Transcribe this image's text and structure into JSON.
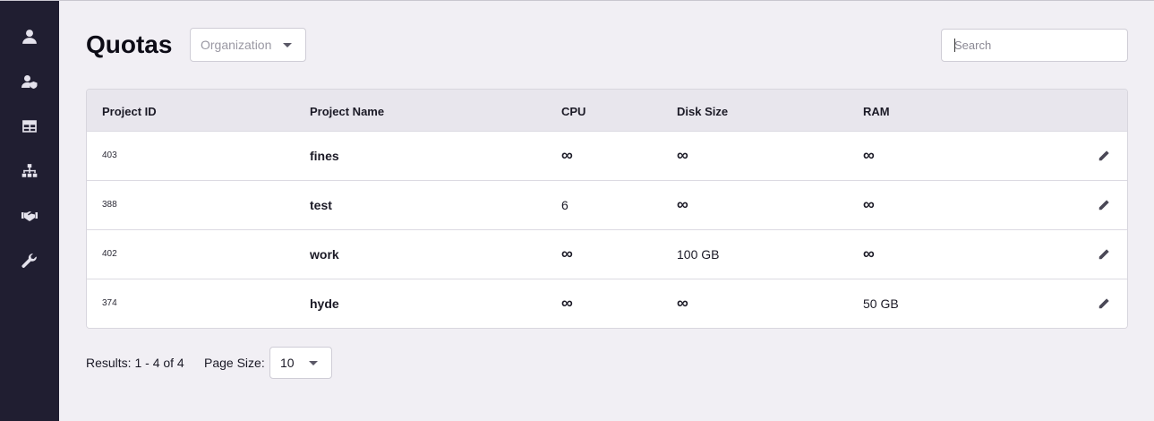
{
  "page": {
    "title": "Quotas"
  },
  "sidebar": {
    "items": [
      {
        "icon": "user-icon",
        "label": "Users"
      },
      {
        "icon": "user-shield-icon",
        "label": "Admins"
      },
      {
        "icon": "table-icon",
        "label": "Projects"
      },
      {
        "icon": "sitemap-icon",
        "label": "Organizations"
      },
      {
        "icon": "handshake-icon",
        "label": "Partners"
      },
      {
        "icon": "wrench-icon",
        "label": "Settings"
      }
    ]
  },
  "filters": {
    "organization_placeholder": "Organization",
    "search_placeholder": "Search",
    "search_value": ""
  },
  "table": {
    "columns": [
      "Project ID",
      "Project Name",
      "CPU",
      "Disk Size",
      "RAM"
    ],
    "rows": [
      {
        "id": "403",
        "name": "fines",
        "cpu": "∞",
        "disk": "∞",
        "ram": "∞"
      },
      {
        "id": "388",
        "name": "test",
        "cpu": "6",
        "disk": "∞",
        "ram": "∞"
      },
      {
        "id": "402",
        "name": "work",
        "cpu": "∞",
        "disk": "100 GB",
        "ram": "∞"
      },
      {
        "id": "374",
        "name": "hyde",
        "cpu": "∞",
        "disk": "∞",
        "ram": "50 GB"
      }
    ]
  },
  "pagination": {
    "results_text": "Results: 1 - 4 of 4",
    "page_size_label": "Page Size:",
    "page_size_value": "10"
  },
  "colors": {
    "sidebar_bg": "#201e31",
    "page_bg": "#f1eff4",
    "header_bg": "#e8e6ed"
  }
}
